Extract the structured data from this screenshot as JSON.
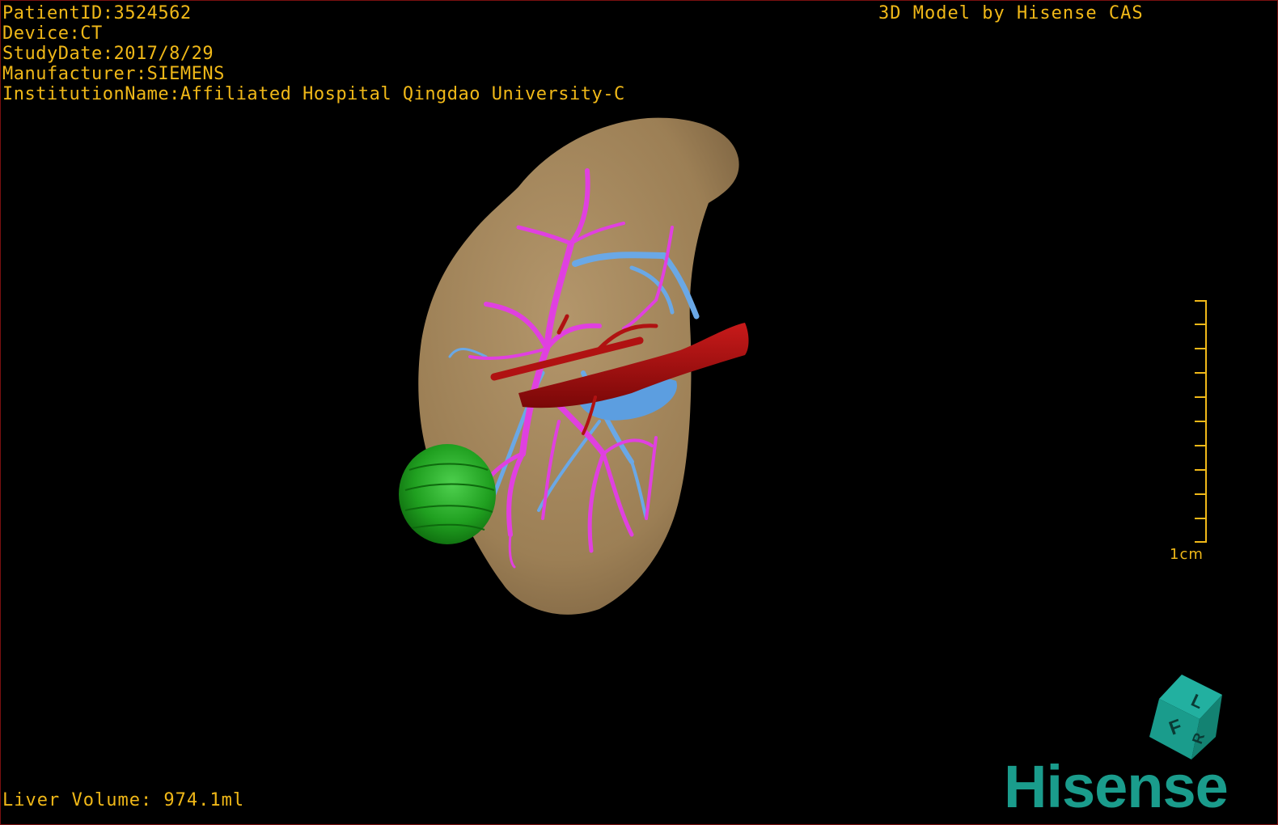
{
  "overlay": {
    "patient_id": "PatientID:3524562",
    "device": "Device:CT",
    "study_date": "StudyDate:2017/8/29",
    "manufacturer": "Manufacturer:SIEMENS",
    "institution": "InstitutionName:Affiliated Hospital Qingdao University-C",
    "watermark": "3D Model by Hisense CAS",
    "liver_volume": "Liver Volume: 974.1ml"
  },
  "scale": {
    "label": "1cm"
  },
  "orientation_cube": {
    "face_labels": [
      "F",
      "L",
      "R"
    ]
  },
  "brand": {
    "logo_text": "Hisense"
  },
  "colors": {
    "overlay_text": "#f0b818",
    "liver": "#a3865d",
    "portal_vein": "#e040e0",
    "hepatic_vein": "#6aa8e6",
    "artery": "#a01010",
    "tumor": "#1ea01e",
    "brand": "#1a9c8c",
    "cube": "#1a9c8c"
  }
}
